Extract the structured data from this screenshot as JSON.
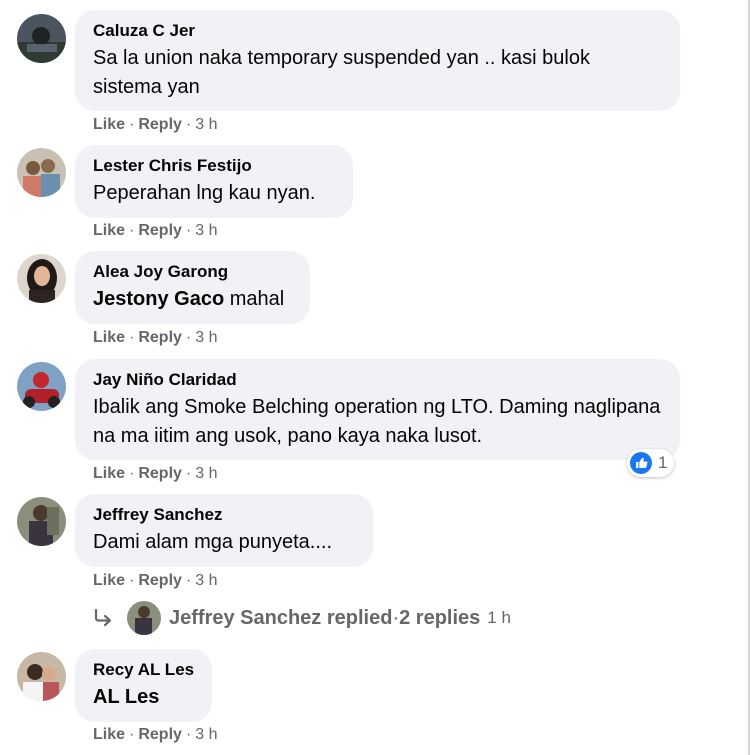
{
  "actions": {
    "like": "Like",
    "reply": "Reply",
    "dot": "·"
  },
  "comments": [
    {
      "author": "Caluza C Jer",
      "text": "Sa la union naka temporary suspended yan .. kasi bulok sistema yan",
      "time": "3 h"
    },
    {
      "author": "Lester Chris Festijo",
      "text": "Peperahan lng kau nyan.",
      "time": "3 h"
    },
    {
      "author": "Alea Joy Garong",
      "mention": "Jestony Gaco",
      "text": " mahal",
      "time": "3 h"
    },
    {
      "author": "Jay Niño Claridad",
      "text": "Ibalik ang Smoke Belching operation ng LTO. Daming naglipana na ma iitim ang usok, pano kaya naka lusot.",
      "time": "3 h",
      "reaction_count": "1"
    },
    {
      "author": "Jeffrey Sanchez",
      "text": "Dami alam mga punyeta....",
      "time": "3 h"
    },
    {
      "author": "Recy AL Les",
      "mention": "AL Les",
      "time": "3 h"
    }
  ],
  "replies_summary": {
    "name": "Jeffrey Sanchez replied",
    "separator": " · ",
    "count": "2 replies",
    "time": "1 h"
  },
  "colors": {
    "bubble": "#f0f2f5",
    "secondary_text": "#65676b",
    "like_blue": "#1877f2"
  }
}
